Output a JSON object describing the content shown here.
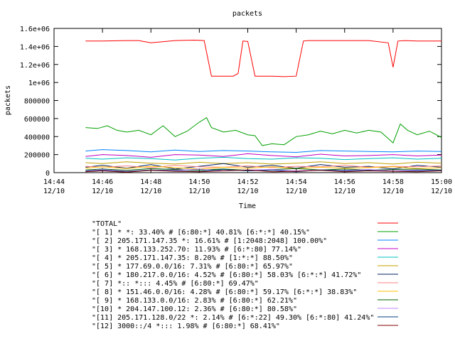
{
  "chart_data": {
    "type": "line",
    "title": "packets",
    "xlabel": "Time",
    "ylabel": "packets",
    "grid": false,
    "legend_position": "bottom",
    "x_ticks": [
      {
        "time": "14:44",
        "date": "12/10",
        "t": 0
      },
      {
        "time": "14:46",
        "date": "12/10",
        "t": 2
      },
      {
        "time": "14:48",
        "date": "12/10",
        "t": 4
      },
      {
        "time": "14:50",
        "date": "12/10",
        "t": 6
      },
      {
        "time": "14:52",
        "date": "12/10",
        "t": 8
      },
      {
        "time": "14:54",
        "date": "12/10",
        "t": 10
      },
      {
        "time": "14:56",
        "date": "12/10",
        "t": 12
      },
      {
        "time": "14:58",
        "date": "12/10",
        "t": 14
      },
      {
        "time": "15:00",
        "date": "12/10",
        "t": 16
      }
    ],
    "xlim": [
      0,
      16
    ],
    "ylim": [
      0,
      1600000
    ],
    "y_ticks": [
      {
        "label": "0",
        "value": 0
      },
      {
        "label": "200000",
        "value": 200000
      },
      {
        "label": "400000",
        "value": 400000
      },
      {
        "label": "600000",
        "value": 600000
      },
      {
        "label": "800000",
        "value": 800000
      },
      {
        "label": "1e+06",
        "value": 1000000
      },
      {
        "label": "1.2e+06",
        "value": 1200000
      },
      {
        "label": "1.4e+06",
        "value": 1400000
      },
      {
        "label": "1.6e+06",
        "value": 1600000
      }
    ],
    "series": [
      {
        "name": "\"TOTAL\"",
        "color": "#ff0000",
        "x": [
          1.3,
          2,
          3,
          3.5,
          4,
          5,
          5.8,
          6.2,
          6.5,
          7,
          7.4,
          7.6,
          7.8,
          8,
          8.3,
          8.7,
          9,
          9.5,
          10,
          10.3,
          10.5,
          11,
          12,
          13,
          13.8,
          14,
          14.2,
          14.5,
          15,
          16
        ],
        "y": [
          1460000,
          1460000,
          1465000,
          1465000,
          1440000,
          1465000,
          1470000,
          1465000,
          1070000,
          1070000,
          1070000,
          1100000,
          1460000,
          1455000,
          1070000,
          1070000,
          1070000,
          1065000,
          1070000,
          1460000,
          1465000,
          1465000,
          1465000,
          1465000,
          1440000,
          1170000,
          1460000,
          1465000,
          1460000,
          1460000
        ]
      },
      {
        "name": "\"[ 1] * *: 33.40% # [6:80:*] 40.81% [6:*:*] 40.15%\"",
        "color": "#00a000",
        "x": [
          1.3,
          1.8,
          2.2,
          2.6,
          3,
          3.5,
          4,
          4.5,
          5,
          5.5,
          6,
          6.3,
          6.5,
          7,
          7.5,
          8,
          8.3,
          8.6,
          9,
          9.5,
          10,
          10.5,
          11,
          11.5,
          12,
          12.5,
          13,
          13.5,
          14,
          14.3,
          14.6,
          15,
          15.5,
          16
        ],
        "y": [
          500000,
          490000,
          520000,
          470000,
          450000,
          470000,
          420000,
          520000,
          400000,
          460000,
          560000,
          610000,
          500000,
          450000,
          470000,
          420000,
          410000,
          300000,
          320000,
          310000,
          400000,
          420000,
          460000,
          430000,
          470000,
          440000,
          470000,
          450000,
          330000,
          540000,
          470000,
          420000,
          460000,
          390000
        ]
      },
      {
        "name": "\"[ 2] 205.171.147.35 *: 16.61% # [1:2048:2048] 100.00%\"",
        "color": "#0080ff",
        "x": [
          1.3,
          2,
          3,
          4,
          5,
          6,
          7,
          8,
          9,
          10,
          11,
          12,
          13,
          14,
          15,
          16
        ],
        "y": [
          240000,
          255000,
          245000,
          230000,
          250000,
          235000,
          245000,
          240000,
          230000,
          225000,
          245000,
          240000,
          235000,
          230000,
          240000,
          235000
        ]
      },
      {
        "name": "\"[ 3] * 168.133.252.70: 11.93% # [6:*:80] 77.14%\"",
        "color": "#c000c0",
        "x": [
          1.3,
          2,
          3,
          4,
          5,
          6,
          7,
          8,
          9,
          10,
          11,
          12,
          13,
          14,
          15,
          16
        ],
        "y": [
          180000,
          200000,
          190000,
          170000,
          200000,
          195000,
          180000,
          210000,
          190000,
          175000,
          205000,
          185000,
          190000,
          200000,
          185000,
          195000
        ]
      },
      {
        "name": "\"[ 4] * 205.171.147.35: 8.20% # [1:*:*] 88.50%\"",
        "color": "#00c0c0",
        "x": [
          1.3,
          2,
          3,
          4,
          5,
          6,
          7,
          8,
          9,
          10,
          11,
          12,
          13,
          14,
          15,
          16
        ],
        "y": [
          160000,
          150000,
          165000,
          155000,
          140000,
          160000,
          170000,
          155000,
          150000,
          165000,
          160000,
          145000,
          155000,
          165000,
          150000,
          160000
        ]
      },
      {
        "name": "\"[ 5] * 177.69.0.0/16: 7.31% # [6:80:*] 65.97%\"",
        "color": "#c0a000",
        "x": [
          1.3,
          2,
          3,
          4,
          5,
          6,
          7,
          8,
          9,
          10,
          11,
          12,
          13,
          14,
          15,
          16
        ],
        "y": [
          110000,
          100000,
          120000,
          105000,
          95000,
          115000,
          100000,
          110000,
          95000,
          105000,
          120000,
          100000,
          110000,
          95000,
          115000,
          105000
        ]
      },
      {
        "name": "\"[ 6] * 180.217.0.0/16: 4.52% # [6:80:*] 58.03% [6:*:*] 41.72%\"",
        "color": "#002060",
        "x": [
          1.3,
          2,
          3,
          4,
          5,
          6,
          7,
          8,
          9,
          10,
          11,
          12,
          13,
          14,
          15,
          16
        ],
        "y": [
          60000,
          80000,
          50000,
          90000,
          40000,
          70000,
          100000,
          60000,
          80000,
          50000,
          90000,
          60000,
          70000,
          40000,
          80000,
          60000
        ]
      },
      {
        "name": "\"[ 7] *:: *::: 4.45% # [6:80:*] 69.47%\"",
        "color": "#ff8080",
        "x": [
          1.3,
          2,
          3,
          4,
          5,
          6,
          7,
          8,
          9,
          10,
          11,
          12,
          13,
          14,
          15,
          16
        ],
        "y": [
          70000,
          60000,
          75000,
          55000,
          80000,
          65000,
          60000,
          75000,
          55000,
          70000,
          65000,
          80000,
          60000,
          70000,
          65000,
          75000
        ]
      },
      {
        "name": "\"[ 8] * 151.46.0.0/16: 4.28% # [6:80:*] 59.17% [6:*:*] 38.83%\"",
        "color": "#ffc000",
        "x": [
          1.3,
          2,
          3,
          4,
          5,
          6,
          7,
          8,
          9,
          10,
          11,
          12,
          13,
          14,
          15,
          16
        ],
        "y": [
          50000,
          65000,
          45000,
          70000,
          55000,
          40000,
          60000,
          50000,
          65000,
          45000,
          60000,
          50000,
          55000,
          65000,
          45000,
          55000
        ]
      },
      {
        "name": "\"[ 9] * 168.133.0.0/16: 2.83% # [6:80:*] 62.21%\"",
        "color": "#006000",
        "x": [
          1.3,
          2,
          3,
          4,
          5,
          6,
          7,
          8,
          9,
          10,
          11,
          12,
          13,
          14,
          15,
          16
        ],
        "y": [
          30000,
          40000,
          25000,
          45000,
          35000,
          30000,
          40000,
          25000,
          35000,
          45000,
          30000,
          40000,
          30000,
          35000,
          40000,
          30000
        ]
      },
      {
        "name": "\"[10] * 204.147.100.12: 2.36% # [6:80:*] 80.58%\"",
        "color": "#c080ff",
        "x": [
          1.3,
          2,
          3,
          4,
          5,
          6,
          7,
          8,
          9,
          10,
          11,
          12,
          13,
          14,
          15,
          16
        ],
        "y": [
          20000,
          35000,
          15000,
          30000,
          25000,
          40000,
          20000,
          30000,
          35000,
          20000,
          30000,
          25000,
          35000,
          20000,
          30000,
          25000
        ]
      },
      {
        "name": "\"[11] 205.171.128.0/22 *: 2.14% # [6:*:22] 49.30% [6:*:80] 41.24%\"",
        "color": "#004080",
        "x": [
          1.3,
          2,
          3,
          4,
          5,
          6,
          7,
          8,
          9,
          10,
          11,
          12,
          13,
          14,
          15,
          16
        ],
        "y": [
          15000,
          25000,
          10000,
          30000,
          20000,
          15000,
          35000,
          20000,
          25000,
          10000,
          30000,
          20000,
          25000,
          15000,
          20000,
          25000
        ]
      },
      {
        "name": "\"[12] 3000::/4 *::: 1.98% # [6:80:*] 68.41%\"",
        "color": "#800000",
        "x": [
          1.3,
          2,
          3,
          4,
          5,
          6,
          7,
          8,
          9,
          10,
          11,
          12,
          13,
          14,
          15,
          16
        ],
        "y": [
          10000,
          20000,
          5000,
          25000,
          15000,
          10000,
          20000,
          30000,
          10000,
          15000,
          25000,
          10000,
          20000,
          15000,
          10000,
          20000
        ]
      }
    ]
  }
}
